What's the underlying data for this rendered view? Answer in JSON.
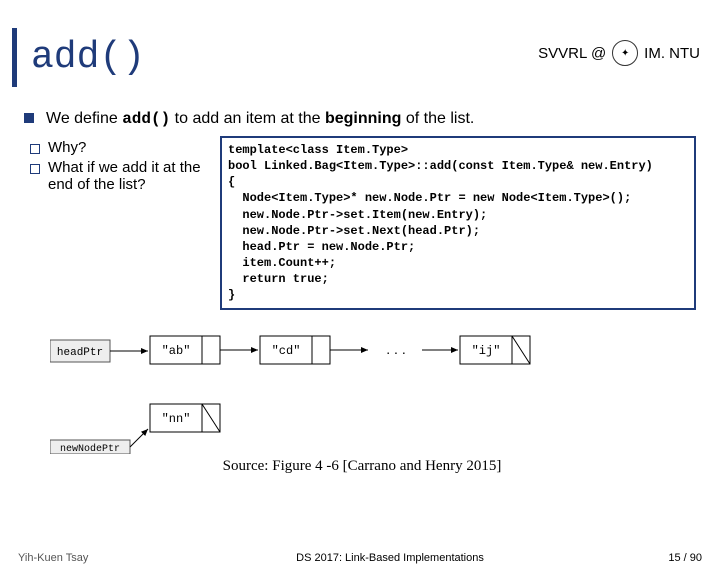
{
  "header": {
    "org_left": "SVVRL @",
    "org_right": "IM. NTU"
  },
  "title": "add()",
  "main_text_pre": "We define ",
  "main_text_code": "add()",
  "main_text_mid": " to add an item at the ",
  "main_text_bold": "beginning",
  "main_text_post": " of the list.",
  "sub1": "Why?",
  "sub2": "What if we add it at the end of the list?",
  "code": "template<class Item.Type>\nbool Linked.Bag<Item.Type>::add(const Item.Type& new.Entry)\n{\n  Node<Item.Type>* new.Node.Ptr = new Node<Item.Type>();\n  new.Node.Ptr->set.Item(new.Entry);\n  new.Node.Ptr->set.Next(head.Ptr);\n  head.Ptr = new.Node.Ptr;\n  item.Count++;\n  return true;\n}",
  "diagram": {
    "top_nodes": [
      "\"ab\"",
      "\"cd\"",
      "\"ij\""
    ],
    "headptr": "headPtr",
    "newptr": "newNodePtr",
    "newnode": "\"nn\""
  },
  "caption": "Source: Figure 4 -6 [Carrano and Henry 2015]",
  "footer": {
    "author": "Yih-Kuen Tsay",
    "course": "DS 2017: Link-Based Implementations",
    "page": "15 / 90"
  }
}
